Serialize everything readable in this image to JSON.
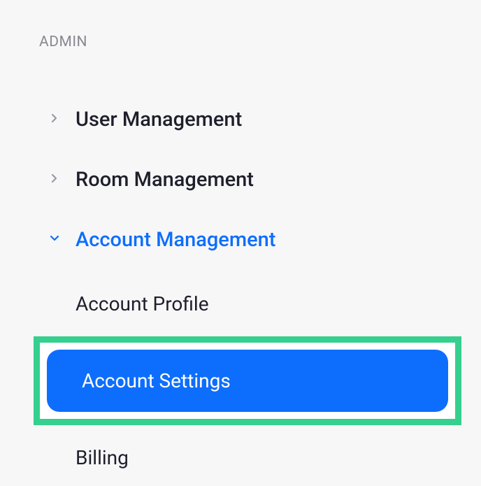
{
  "section": {
    "title": "ADMIN"
  },
  "nav": {
    "items": [
      {
        "label": "User Management",
        "expanded": false
      },
      {
        "label": "Room Management",
        "expanded": false
      },
      {
        "label": "Account Management",
        "expanded": true
      }
    ]
  },
  "subnav": {
    "items": [
      {
        "label": "Account Profile",
        "active": false
      },
      {
        "label": "Account Settings",
        "active": true
      },
      {
        "label": "Billing",
        "active": false
      }
    ]
  },
  "colors": {
    "accent": "#0d6efd",
    "highlight_border": "#35cf8e",
    "text": "#1f1f2c",
    "muted": "#888890",
    "bg": "#f7f7f8"
  }
}
